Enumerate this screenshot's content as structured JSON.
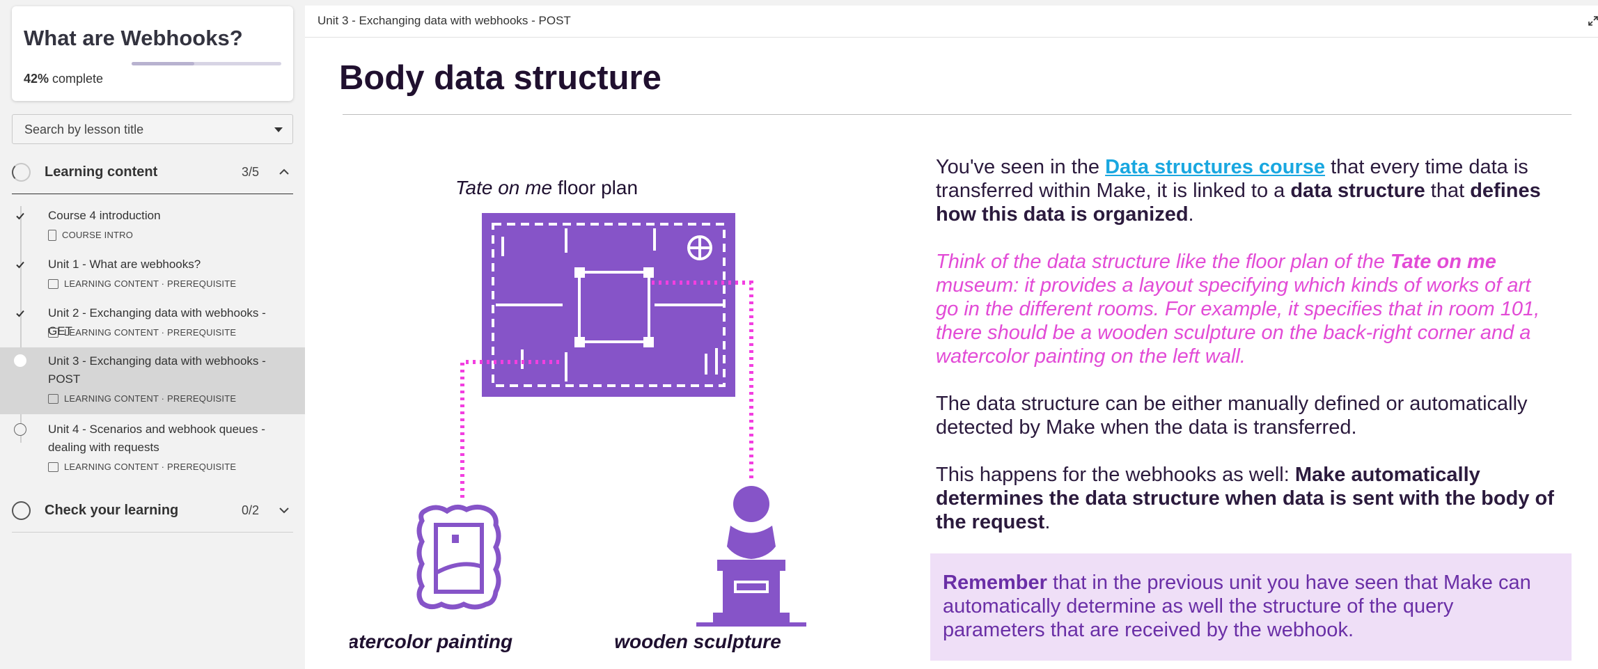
{
  "sidebar": {
    "course_title": "What are Webhooks?",
    "progress_percent": "42%",
    "progress_suffix": " complete",
    "progress_value": 0.42,
    "search_placeholder": "Search by lesson title",
    "sections": [
      {
        "label": "Learning content",
        "count": "3/5",
        "expanded": true
      },
      {
        "label": "Check your learning",
        "count": "0/2",
        "expanded": false
      }
    ],
    "lessons": [
      {
        "title": "Course 4 introduction",
        "meta": "COURSE INTRO",
        "status": "done"
      },
      {
        "title": "Unit 1 - What are webhooks?",
        "meta": "LEARNING CONTENT · PREREQUISITE",
        "status": "done"
      },
      {
        "title": "Unit 2 - Exchanging data with webhooks - GET",
        "meta": "LEARNING CONTENT · PREREQUISITE",
        "status": "done"
      },
      {
        "title": "Unit 3 - Exchanging data with webhooks - POST",
        "meta": "LEARNING CONTENT · PREREQUISITE",
        "status": "current"
      },
      {
        "title": "Unit 4 - Scenarios and webhook queues - dealing with requests",
        "meta": "LEARNING CONTENT · PREREQUISITE",
        "status": "todo"
      }
    ]
  },
  "main": {
    "breadcrumb": "Unit 3 - Exchanging data with webhooks - POST",
    "title": "Body data structure",
    "illustration": {
      "caption_italic": "Tate on me",
      "caption_rest": " floor plan",
      "label_left": "watercolor painting",
      "label_right": "wooden sculpture",
      "accent": "#8654c8",
      "dotted": "#f23fe0"
    },
    "p1": {
      "t1": "You've seen in the ",
      "link": "Data structures course",
      "t2": " that every time data is transferred within Make, it is linked to a ",
      "b1": "data structure",
      "t3": " that ",
      "b2": "defines how this data is organized",
      "t4": "."
    },
    "p2": {
      "t1": "Think of the data structure like the floor plan of the ",
      "b1": "Tate on me",
      "t2": " museum: it provides a layout specifying which kinds of works of art go in the different rooms. For example, it specifies that in room 101, there should be a wooden sculpture on the back-right corner and a watercolor painting on the left wall."
    },
    "p3": "The data structure can be either manually defined or automatically detected by Make when the data is transferred.",
    "p4": {
      "t1": "This happens for the webhooks as well: ",
      "b1": "Make automatically determines the data structure when data is sent with the body of the request",
      "t2": "."
    },
    "remember": {
      "b1": "Remember",
      "t1": " that in the previous unit you have seen that Make can automatically determine as well the structure of the query parameters that are received by the webhook."
    }
  }
}
